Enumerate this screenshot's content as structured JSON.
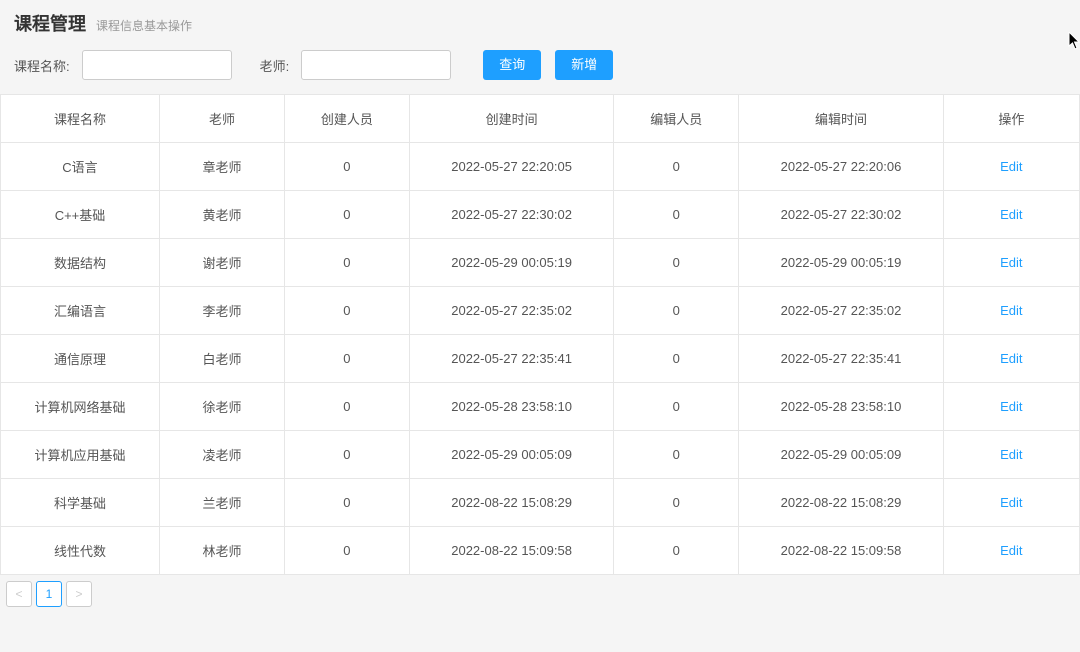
{
  "header": {
    "title": "课程管理",
    "subtitle": "课程信息基本操作"
  },
  "search": {
    "course_label": "课程名称:",
    "course_value": "",
    "teacher_label": "老师:",
    "teacher_value": "",
    "query_btn": "查询",
    "add_btn": "新增"
  },
  "table": {
    "columns": [
      "课程名称",
      "老师",
      "创建人员",
      "创建时间",
      "编辑人员",
      "编辑时间",
      "操作"
    ],
    "edit_label": "Edit",
    "rows": [
      {
        "name": "C语言",
        "teacher": "章老师",
        "creator": "0",
        "create_time": "2022-05-27 22:20:05",
        "editor": "0",
        "edit_time": "2022-05-27 22:20:06"
      },
      {
        "name": "C++基础",
        "teacher": "黄老师",
        "creator": "0",
        "create_time": "2022-05-27 22:30:02",
        "editor": "0",
        "edit_time": "2022-05-27 22:30:02"
      },
      {
        "name": "数据结构",
        "teacher": "谢老师",
        "creator": "0",
        "create_time": "2022-05-29 00:05:19",
        "editor": "0",
        "edit_time": "2022-05-29 00:05:19"
      },
      {
        "name": "汇编语言",
        "teacher": "李老师",
        "creator": "0",
        "create_time": "2022-05-27 22:35:02",
        "editor": "0",
        "edit_time": "2022-05-27 22:35:02"
      },
      {
        "name": "通信原理",
        "teacher": "白老师",
        "creator": "0",
        "create_time": "2022-05-27 22:35:41",
        "editor": "0",
        "edit_time": "2022-05-27 22:35:41"
      },
      {
        "name": "计算机网络基础",
        "teacher": "徐老师",
        "creator": "0",
        "create_time": "2022-05-28 23:58:10",
        "editor": "0",
        "edit_time": "2022-05-28 23:58:10"
      },
      {
        "name": "计算机应用基础",
        "teacher": "凌老师",
        "creator": "0",
        "create_time": "2022-05-29 00:05:09",
        "editor": "0",
        "edit_time": "2022-05-29 00:05:09"
      },
      {
        "name": "科学基础",
        "teacher": "兰老师",
        "creator": "0",
        "create_time": "2022-08-22 15:08:29",
        "editor": "0",
        "edit_time": "2022-08-22 15:08:29"
      },
      {
        "name": "线性代数",
        "teacher": "林老师",
        "creator": "0",
        "create_time": "2022-08-22 15:09:58",
        "editor": "0",
        "edit_time": "2022-08-22 15:09:58"
      }
    ]
  },
  "pager": {
    "prev": "<",
    "next": ">",
    "current": "1"
  }
}
